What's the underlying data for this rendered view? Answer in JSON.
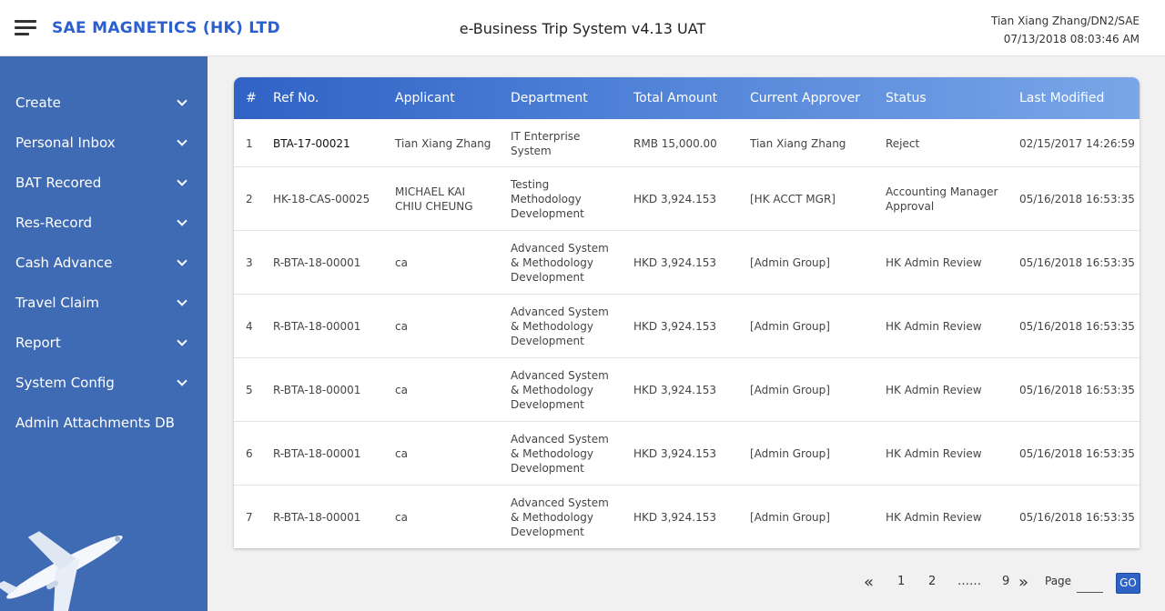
{
  "header": {
    "brand": "SAE MAGNETICS (HK) LTD",
    "title": "e-Business Trip System v4.13 UAT",
    "user": "Tian Xiang Zhang/DN2/SAE",
    "datetime": "07/13/2018 08:03:46 AM"
  },
  "sidebar": {
    "items": [
      {
        "label": "Create",
        "expandable": true
      },
      {
        "label": "Personal Inbox",
        "expandable": true
      },
      {
        "label": "BAT Recored",
        "expandable": true
      },
      {
        "label": "Res-Record",
        "expandable": true
      },
      {
        "label": "Cash Advance",
        "expandable": true
      },
      {
        "label": "Travel Claim",
        "expandable": true
      },
      {
        "label": "Report",
        "expandable": true
      },
      {
        "label": "System Config",
        "expandable": true
      },
      {
        "label": "Admin Attachments DB",
        "expandable": false
      }
    ]
  },
  "table": {
    "columns": [
      "#",
      "Ref No.",
      "Applicant",
      "Department",
      "Total Amount",
      "Current Approver",
      "Status",
      "Last Modified"
    ],
    "rows": [
      {
        "num": "1",
        "ref": "BTA-17-00021",
        "applicant": [
          "Tian Xiang Zhang"
        ],
        "department": [
          "IT Enterprise",
          "System"
        ],
        "amount": "RMB 15,000.00",
        "approver": "Tian Xiang Zhang",
        "status": [
          "Reject"
        ],
        "modified": "02/15/2017 14:26:59"
      },
      {
        "num": "2",
        "ref": "HK-18-CAS-00025",
        "applicant": [
          "MICHAEL KAI",
          "CHIU CHEUNG"
        ],
        "department": [
          "Testing",
          "Methodology",
          "Development"
        ],
        "amount": "HKD 3,924.153",
        "approver": "[HK ACCT MGR]",
        "status": [
          "Accounting Manager",
          "Approval"
        ],
        "modified": "05/16/2018 16:53:35"
      },
      {
        "num": "3",
        "ref": "R-BTA-18-00001",
        "applicant": [
          "ca"
        ],
        "department": [
          "Advanced System",
          "& Methodology",
          "Development"
        ],
        "amount": "HKD 3,924.153",
        "approver": "[Admin Group]",
        "status": [
          "HK Admin Review"
        ],
        "modified": "05/16/2018 16:53:35"
      },
      {
        "num": "4",
        "ref": "R-BTA-18-00001",
        "applicant": [
          "ca"
        ],
        "department": [
          "Advanced System",
          "& Methodology",
          "Development"
        ],
        "amount": "HKD 3,924.153",
        "approver": "[Admin Group]",
        "status": [
          "HK Admin Review"
        ],
        "modified": "05/16/2018 16:53:35"
      },
      {
        "num": "5",
        "ref": "R-BTA-18-00001",
        "applicant": [
          "ca"
        ],
        "department": [
          "Advanced System",
          "& Methodology",
          "Development"
        ],
        "amount": "HKD 3,924.153",
        "approver": "[Admin Group]",
        "status": [
          "HK Admin Review"
        ],
        "modified": "05/16/2018 16:53:35"
      },
      {
        "num": "6",
        "ref": "R-BTA-18-00001",
        "applicant": [
          "ca"
        ],
        "department": [
          "Advanced System",
          "& Methodology",
          "Development"
        ],
        "amount": "HKD 3,924.153",
        "approver": "[Admin Group]",
        "status": [
          "HK Admin Review"
        ],
        "modified": "05/16/2018 16:53:35"
      },
      {
        "num": "7",
        "ref": "R-BTA-18-00001",
        "applicant": [
          "ca"
        ],
        "department": [
          "Advanced System",
          "& Methodology",
          "Development"
        ],
        "amount": "HKD 3,924.153",
        "approver": "[Admin Group]",
        "status": [
          "HK Admin Review"
        ],
        "modified": "05/16/2018 16:53:35"
      }
    ]
  },
  "pagination": {
    "first_icon": "double-chevron-left-icon",
    "pages": [
      "1",
      "2",
      "……",
      "9"
    ],
    "last_icon": "double-chevron-right-icon",
    "page_label": "Page",
    "page_value": "",
    "go_label": "GO"
  },
  "colors": {
    "sidebar": "#3f6ab4",
    "brand": "#2b5fcf",
    "header_gradient_start": "#2f62c4",
    "header_gradient_end": "#7aa6e8"
  }
}
